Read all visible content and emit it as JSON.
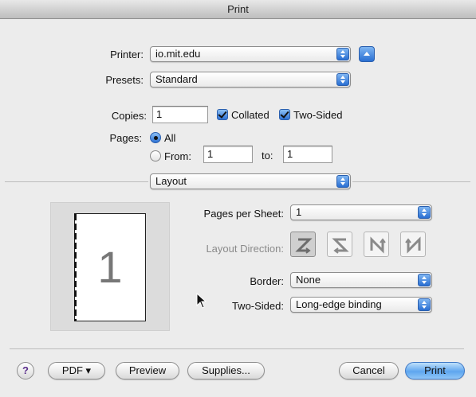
{
  "window": {
    "title": "Print"
  },
  "printer": {
    "label": "Printer:",
    "value": "io.mit.edu"
  },
  "presets": {
    "label": "Presets:",
    "value": "Standard"
  },
  "copies": {
    "label": "Copies:",
    "value": "1",
    "collated_label": "Collated",
    "collated": true,
    "two_sided_label": "Two-Sided",
    "two_sided": true
  },
  "pages": {
    "label": "Pages:",
    "all_label": "All",
    "from_label": "From:",
    "from_value": "1",
    "to_label": "to:",
    "to_value": "1",
    "selected": "All"
  },
  "section": {
    "value": "Layout"
  },
  "layout": {
    "preview_page_number": "1",
    "pages_per_sheet_label": "Pages per Sheet:",
    "pages_per_sheet_value": "1",
    "layout_direction_label": "Layout Direction:",
    "border_label": "Border:",
    "border_value": "None",
    "two_sided_label": "Two-Sided:",
    "two_sided_value": "Long-edge binding"
  },
  "buttons": {
    "help": "?",
    "pdf": "PDF ▾",
    "preview": "Preview",
    "supplies": "Supplies...",
    "cancel": "Cancel",
    "print": "Print"
  },
  "icons": {
    "collapse": "chevron-up-icon",
    "directions": [
      "z-direction-icon",
      "reverse-z-direction-icon",
      "n-direction-icon",
      "reverse-n-direction-icon"
    ]
  },
  "colors": {
    "accent": "#2a6fd2",
    "default_button": "#5ea6ef"
  }
}
